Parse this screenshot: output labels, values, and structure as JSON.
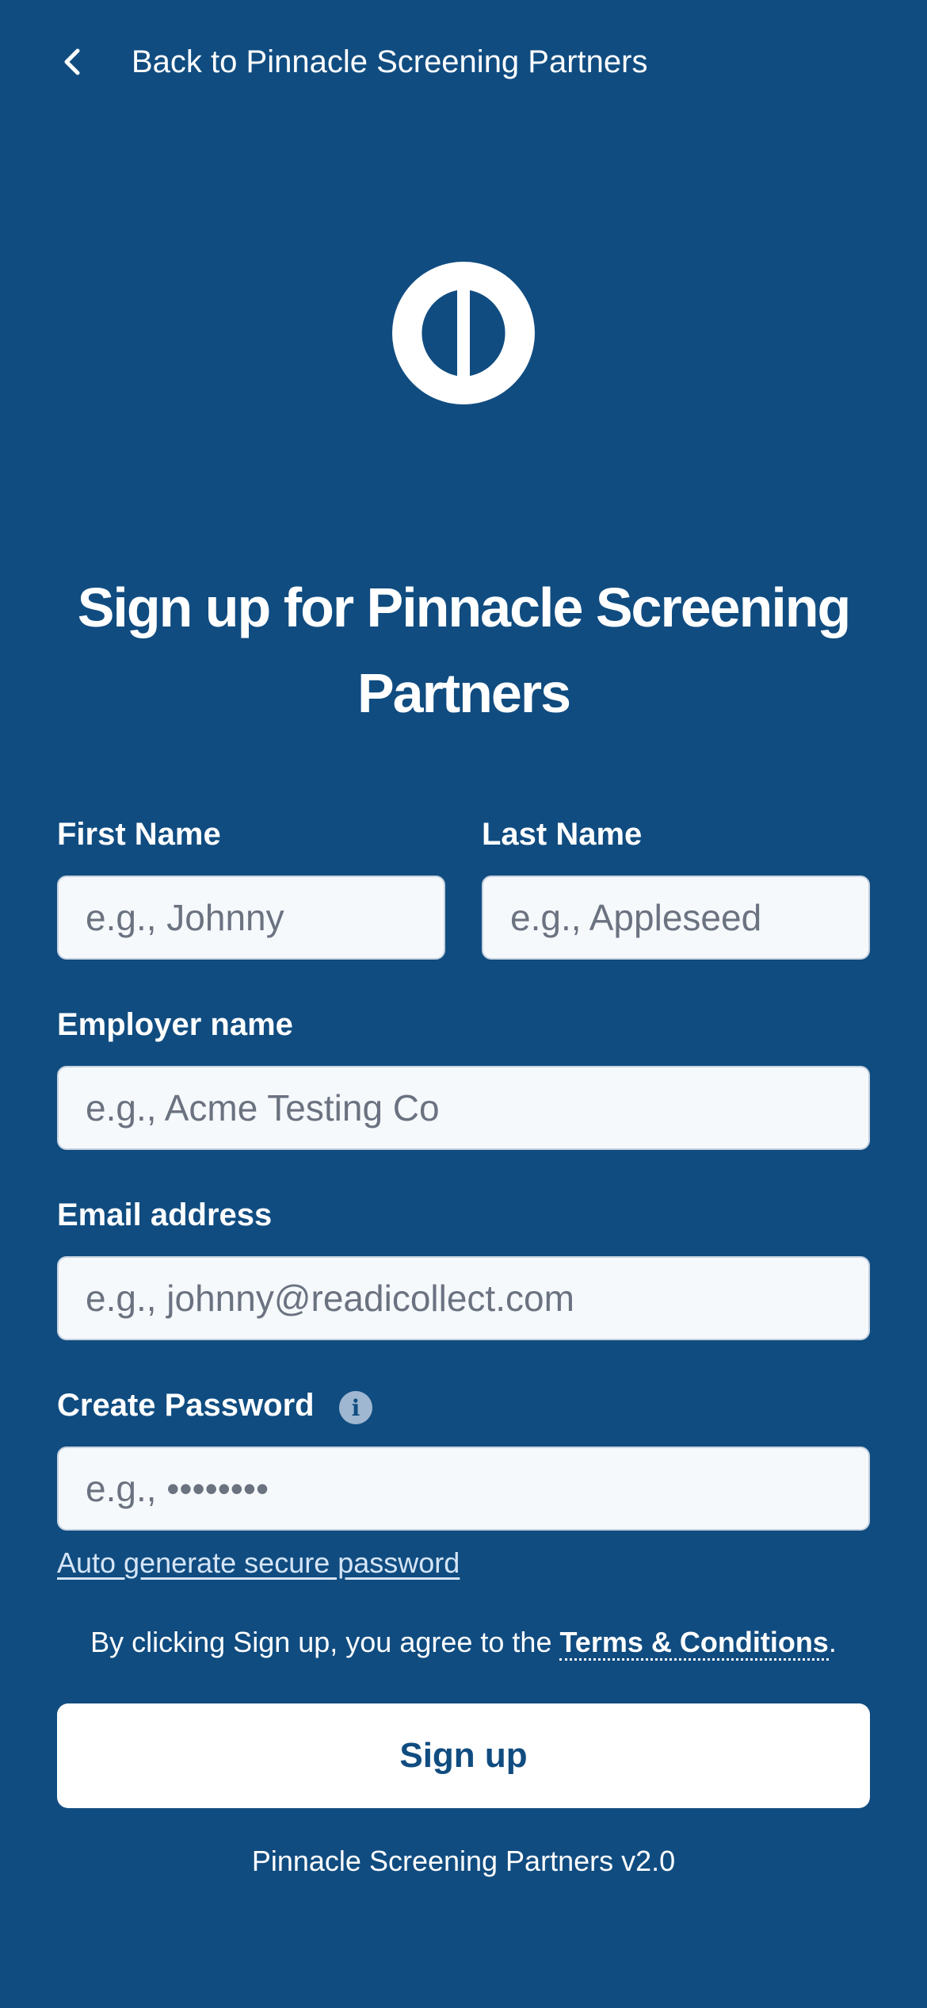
{
  "header": {
    "back_label": "Back to Pinnacle Screening Partners"
  },
  "title": "Sign up for Pinnacle Screening Partners",
  "form": {
    "first_name": {
      "label": "First Name",
      "placeholder": "e.g., Johnny",
      "value": ""
    },
    "last_name": {
      "label": "Last Name",
      "placeholder": "e.g., Appleseed",
      "value": ""
    },
    "employer": {
      "label": "Employer name",
      "placeholder": "e.g., Acme Testing Co",
      "value": ""
    },
    "email": {
      "label": "Email address",
      "placeholder": "e.g., johnny@readicollect.com",
      "value": ""
    },
    "password": {
      "label": "Create Password",
      "placeholder": "e.g., ••••••••",
      "value": "",
      "info_icon": "info-icon"
    },
    "auto_generate_label": "Auto generate secure password"
  },
  "terms": {
    "prefix": "By clicking Sign up, you agree to the ",
    "link": "Terms & Conditions",
    "suffix": "."
  },
  "signup_label": "Sign up",
  "footer": {
    "version": "Pinnacle Screening Partners v2.0"
  },
  "colors": {
    "background": "#104c80",
    "input_background": "#f6f9fc",
    "button_background": "#ffffff",
    "button_text": "#104c80"
  },
  "icons": {
    "back": "chevron-left-icon",
    "logo": "pinnacle-logo"
  }
}
